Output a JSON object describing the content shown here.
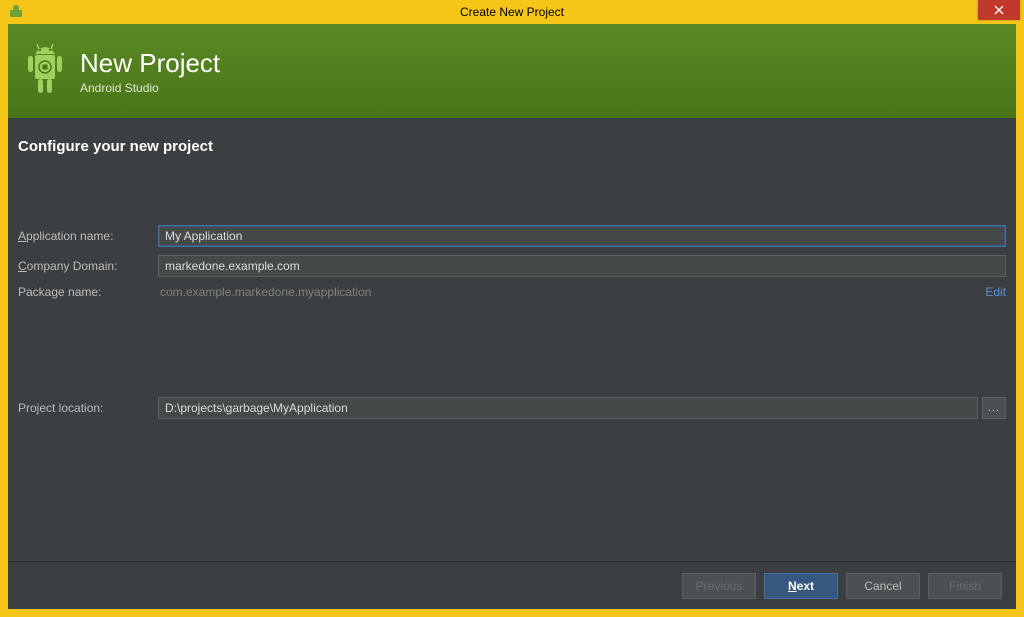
{
  "window": {
    "title": "Create New Project"
  },
  "banner": {
    "title": "New Project",
    "subtitle": "Android Studio"
  },
  "section": {
    "heading": "Configure your new project"
  },
  "form": {
    "app_name": {
      "label_pre": "",
      "mn": "A",
      "label_post": "pplication name:",
      "value": "My Application"
    },
    "company": {
      "label_pre": "",
      "mn": "C",
      "label_post": "ompany Domain:",
      "value": "markedone.example.com"
    },
    "pkg": {
      "label": "Package name:",
      "value": "com.example.markedone.myapplication",
      "edit": "Edit"
    },
    "loc": {
      "label": "Project location:",
      "value": "D:\\projects\\garbage\\MyApplication",
      "browse": "..."
    }
  },
  "footer": {
    "previous": "Previous",
    "next_mn": "N",
    "next_post": "ext",
    "cancel": "Cancel",
    "finish": "Finish"
  }
}
